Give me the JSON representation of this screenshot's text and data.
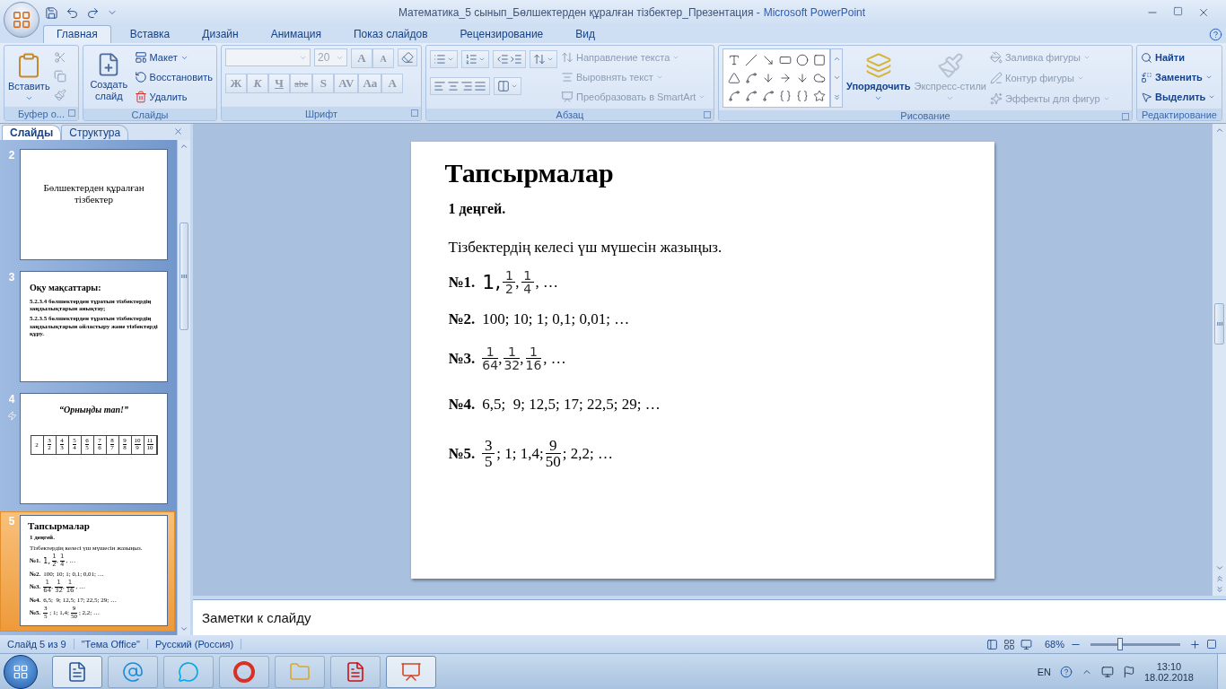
{
  "window": {
    "document_title": "Математика_5 сынып_Бөлшектерден құралған тізбектер_Презентация -",
    "app_name": "Microsoft PowerPoint"
  },
  "ribbon_tabs": [
    {
      "label": "Главная",
      "selected": true
    },
    {
      "label": "Вставка",
      "selected": false
    },
    {
      "label": "Дизайн",
      "selected": false
    },
    {
      "label": "Анимация",
      "selected": false
    },
    {
      "label": "Показ слайдов",
      "selected": false
    },
    {
      "label": "Рецензирование",
      "selected": false
    },
    {
      "label": "Вид",
      "selected": false
    }
  ],
  "ribbon": {
    "clipboard": {
      "label": "Буфер о...",
      "paste": "Вставить"
    },
    "slides": {
      "label": "Слайды",
      "new_slide": "Создать слайд",
      "commands": [
        "Макет",
        "Восстановить",
        "Удалить"
      ]
    },
    "font": {
      "label": "Шрифт",
      "size": "20",
      "grow": "A",
      "shrink": "A",
      "format_buttons": [
        "Ж",
        "К",
        "Ч",
        "abe",
        "S",
        "AV",
        "Aa",
        "A"
      ]
    },
    "paragraph": {
      "label": "Абзац",
      "commands": [
        {
          "label": "Направление текста",
          "disabled": true
        },
        {
          "label": "Выровнять текст",
          "disabled": true
        },
        {
          "label": "Преобразовать в SmartArt",
          "disabled": true
        }
      ]
    },
    "drawing": {
      "label": "Рисование",
      "arrange": {
        "label": "Упорядочить",
        "disabled": false
      },
      "quick_styles": {
        "label": "Экспресс-стили",
        "disabled": true
      },
      "commands": [
        {
          "label": "Заливка фигуры",
          "disabled": true
        },
        {
          "label": "Контур фигуры",
          "disabled": true
        },
        {
          "label": "Эффекты для фигур",
          "disabled": true
        }
      ]
    },
    "editing": {
      "label": "Редактирование",
      "commands": [
        {
          "label": "Найти",
          "disabled": false
        },
        {
          "label": "Заменить",
          "disabled": false
        },
        {
          "label": "Выделить",
          "disabled": false
        }
      ]
    }
  },
  "side_panel": {
    "tabs": [
      {
        "label": "Слайды",
        "selected": true
      },
      {
        "label": "Структура",
        "selected": false
      }
    ],
    "slides": [
      {
        "number": "2",
        "selected": false,
        "animated": false,
        "kind": "title",
        "title": "Бөлшектерден құралған тізбектер"
      },
      {
        "number": "3",
        "selected": false,
        "animated": false,
        "kind": "objectives",
        "title": "Оқу мақсаттары:",
        "bullets": [
          "5.2.3.4 бөлшектерден тұратын тізбектердің заңдылықтарын  анықтау;",
          "5.2.3.5 бөлшектерден тұратын тізбектердің заңдылықтарын ойластыру және тізбектерді құру."
        ]
      },
      {
        "number": "4",
        "selected": false,
        "animated": true,
        "kind": "table",
        "title": "“Орныңды тап!”",
        "cells": [
          {
            "kind": "text",
            "text": "2"
          },
          {
            "kind": "fraction",
            "numerator": "3",
            "denominator": "2"
          },
          {
            "kind": "fraction",
            "numerator": "4",
            "denominator": "3"
          },
          {
            "kind": "fraction",
            "numerator": "5",
            "denominator": "4"
          },
          {
            "kind": "fraction",
            "numerator": "6",
            "denominator": "5"
          },
          {
            "kind": "fraction",
            "numerator": "7",
            "denominator": "6"
          },
          {
            "kind": "fraction",
            "numerator": "8",
            "denominator": "7"
          },
          {
            "kind": "fraction",
            "numerator": "9",
            "denominator": "8"
          },
          {
            "kind": "fraction",
            "numerator": "10",
            "denominator": "9"
          },
          {
            "kind": "fraction",
            "numerator": "11",
            "denominator": "10"
          }
        ]
      },
      {
        "number": "5",
        "selected": true,
        "animated": false,
        "kind": "tasks",
        "title": "Тапсырмалар",
        "level": "1 деңгей.",
        "intro": "Тізбектердің келесі үш мүшесін жазыңыз.",
        "tasks": [
          {
            "label": "№1.",
            "terms": [
              {
                "kind": "text",
                "text": "1,"
              },
              {
                "kind": "fraction",
                "numerator": "1",
                "denominator": "2",
                "after": ","
              },
              {
                "kind": "fraction",
                "numerator": "1",
                "denominator": "4"
              },
              {
                "kind": "text",
                "text": ", …"
              }
            ]
          },
          {
            "label": "№2.",
            "terms": [
              {
                "kind": "text",
                "text": "100; 10; 1; 0,1; 0,01; …"
              }
            ]
          },
          {
            "label": "№3.",
            "terms": [
              {
                "kind": "fraction",
                "numerator": "1",
                "denominator": "64",
                "after": ","
              },
              {
                "kind": "fraction",
                "numerator": "1",
                "denominator": "32",
                "after": ","
              },
              {
                "kind": "fraction",
                "numerator": "1",
                "denominator": "16"
              },
              {
                "kind": "text",
                "text": ", …"
              }
            ]
          },
          {
            "label": "№4.",
            "terms": [
              {
                "kind": "text",
                "text": "6,5;  9; 12,5; 17; 22,5; 29; …"
              }
            ]
          },
          {
            "label": "№5.",
            "terms": [
              {
                "kind": "fraction",
                "numerator": "3",
                "denominator": "5"
              },
              {
                "kind": "text",
                "text": "; 1; 1,4;"
              },
              {
                "kind": "fraction",
                "numerator": "9",
                "denominator": "50"
              },
              {
                "kind": "text",
                "text": "; 2,2; …"
              }
            ]
          }
        ]
      }
    ]
  },
  "current_slide": {
    "kind": "tasks",
    "title": "Тапсырмалар",
    "level": "1 деңгей.",
    "intro": "Тізбектердің келесі үш мүшесін жазыңыз.",
    "tasks": [
      {
        "label": "№1.",
        "terms": [
          {
            "kind": "text",
            "text": "1,"
          },
          {
            "kind": "fraction",
            "numerator": "1",
            "denominator": "2",
            "after": ","
          },
          {
            "kind": "fraction",
            "numerator": "1",
            "denominator": "4"
          },
          {
            "kind": "text",
            "text": ", …"
          }
        ]
      },
      {
        "label": "№2.",
        "terms": [
          {
            "kind": "text",
            "text": "100; 10; 1; 0,1; 0,01; …"
          }
        ]
      },
      {
        "label": "№3.",
        "terms": [
          {
            "kind": "fraction",
            "numerator": "1",
            "denominator": "64",
            "after": ","
          },
          {
            "kind": "fraction",
            "numerator": "1",
            "denominator": "32",
            "after": ","
          },
          {
            "kind": "fraction",
            "numerator": "1",
            "denominator": "16"
          },
          {
            "kind": "text",
            "text": ", …"
          }
        ]
      },
      {
        "label": "№4.",
        "terms": [
          {
            "kind": "text",
            "text": "6,5;  9; 12,5; 17; 22,5; 29; …"
          }
        ]
      },
      {
        "label": "№5.",
        "terms": [
          {
            "kind": "fraction",
            "numerator": "3",
            "denominator": "5"
          },
          {
            "kind": "text",
            "text": "; 1; 1,4;"
          },
          {
            "kind": "fraction",
            "numerator": "9",
            "denominator": "50"
          },
          {
            "kind": "text",
            "text": "; 2,2; …"
          }
        ]
      }
    ]
  },
  "notes": {
    "placeholder": "Заметки к слайду"
  },
  "status_bar": {
    "items": [
      "Слайд 5 из 9",
      "\"Тема Office\"",
      "Русский (Россия)"
    ],
    "zoom": "68%",
    "zoom_slider": {
      "level": 0.33
    }
  },
  "taskbar": {
    "language": "EN",
    "time": "13:10",
    "date": "18.02.2018"
  }
}
